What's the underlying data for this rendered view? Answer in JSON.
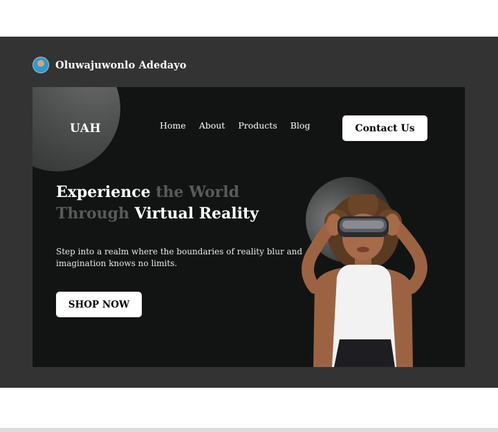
{
  "author": {
    "name": "Oluwajuwonlo Adedayo",
    "avatar_icon": "person-avatar-icon"
  },
  "site": {
    "logo": "UAH",
    "nav": [
      "Home",
      "About",
      "Products",
      "Blog"
    ],
    "contact_label": "Contact Us"
  },
  "hero": {
    "headline_line1_bright": "Experience",
    "headline_line1_muted": " the World",
    "headline_line2_muted": "Through",
    "headline_line2_bright": " Virtual Reality",
    "subtext": "Step into a realm where the boundaries of reality blur and imagination knows no limits.",
    "cta_label": "SHOP NOW",
    "image_icon": "vr-headset-person-image"
  },
  "colors": {
    "frame": "#333333",
    "card": "#121413",
    "button": "#ffffff",
    "muted_text": "#595a59"
  }
}
